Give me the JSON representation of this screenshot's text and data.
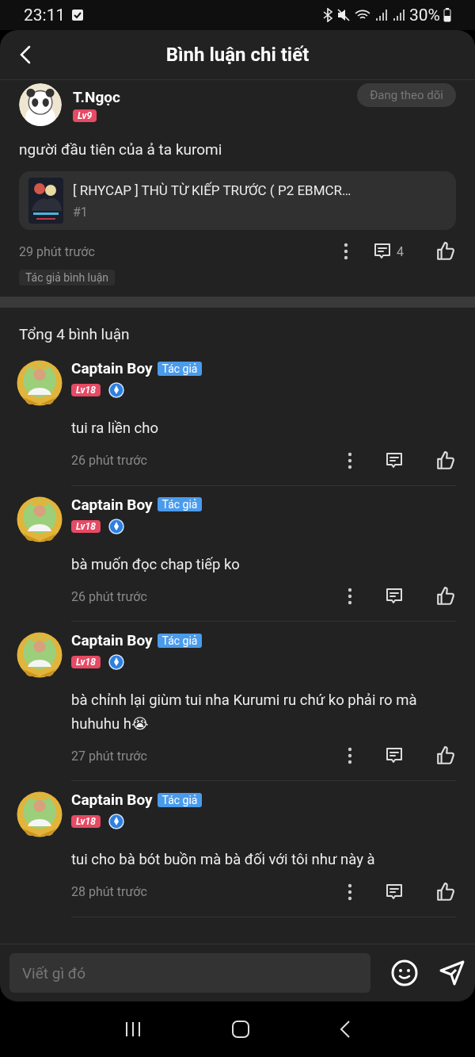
{
  "status_bar": {
    "time": "23:11",
    "battery": "30%"
  },
  "header": {
    "title": "Bình luận chi tiết"
  },
  "main_comment": {
    "author": "T.Ngọc",
    "level": "Lv9",
    "follow_button": "Đang theo dõi",
    "text": "người đầu tiên của ả ta kuromi",
    "linked_story": {
      "title": "[ RHYCAP ] THÙ TỪ KIẾP TRƯỚC ( P2 EBMCR…",
      "chapter": "#1"
    },
    "time": "29 phút trước",
    "reply_count": "4",
    "tag": "Tác giả bình luận"
  },
  "replies_heading": "Tổng 4 bình luận",
  "replies": [
    {
      "author": "Captain Boy",
      "role": "Tác giả",
      "level": "Lv18",
      "text": "tui ra liền cho",
      "time": "26 phút trước"
    },
    {
      "author": "Captain Boy",
      "role": "Tác giả",
      "level": "Lv18",
      "text": "bà muốn đọc chap tiếp ko",
      "time": "26 phút trước"
    },
    {
      "author": "Captain Boy",
      "role": "Tác giả",
      "level": "Lv18",
      "text": "bà chỉnh lại giùm tui nha Kurumi ru chứ ko phải ro mà huhuhu h😭",
      "time": "27 phút trước"
    },
    {
      "author": "Captain Boy",
      "role": "Tác giả",
      "level": "Lv18",
      "text": "tui cho bà bót buồn mà bà đối với tôi như này à",
      "time": "28 phút trước"
    }
  ],
  "composer": {
    "placeholder": "Viết gì đó"
  }
}
